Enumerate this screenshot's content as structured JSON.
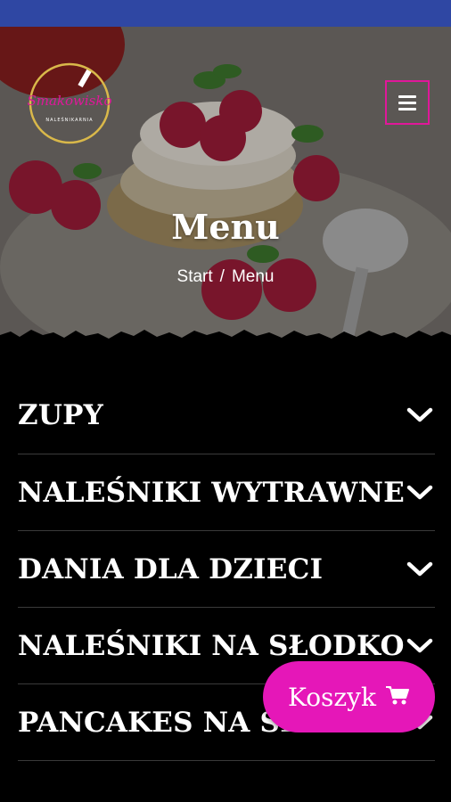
{
  "colors": {
    "status_bar": "#2f47a3",
    "accent": "#e0179a",
    "cart": "#e517b8",
    "background": "#000000"
  },
  "header": {
    "logo_text": "SMAKOWISKO",
    "logo_subtext": "NALEŚNIKARNIA",
    "menu_icon": "hamburger-icon"
  },
  "hero": {
    "title": "Menu",
    "breadcrumb": {
      "home": "Start",
      "separator": "/",
      "current": "Menu"
    }
  },
  "menu": {
    "categories": [
      {
        "label": "ZUPY"
      },
      {
        "label": "NALEŚNIKI WYTRAWNE"
      },
      {
        "label": "DANIA DLA DZIECI"
      },
      {
        "label": "NALEŚNIKI NA SŁODKO"
      },
      {
        "label": "PANCAKES NA SŁODKO"
      }
    ],
    "expand_icon": "chevron-down-icon"
  },
  "cart": {
    "label": "Koszyk",
    "icon": "cart-icon"
  }
}
